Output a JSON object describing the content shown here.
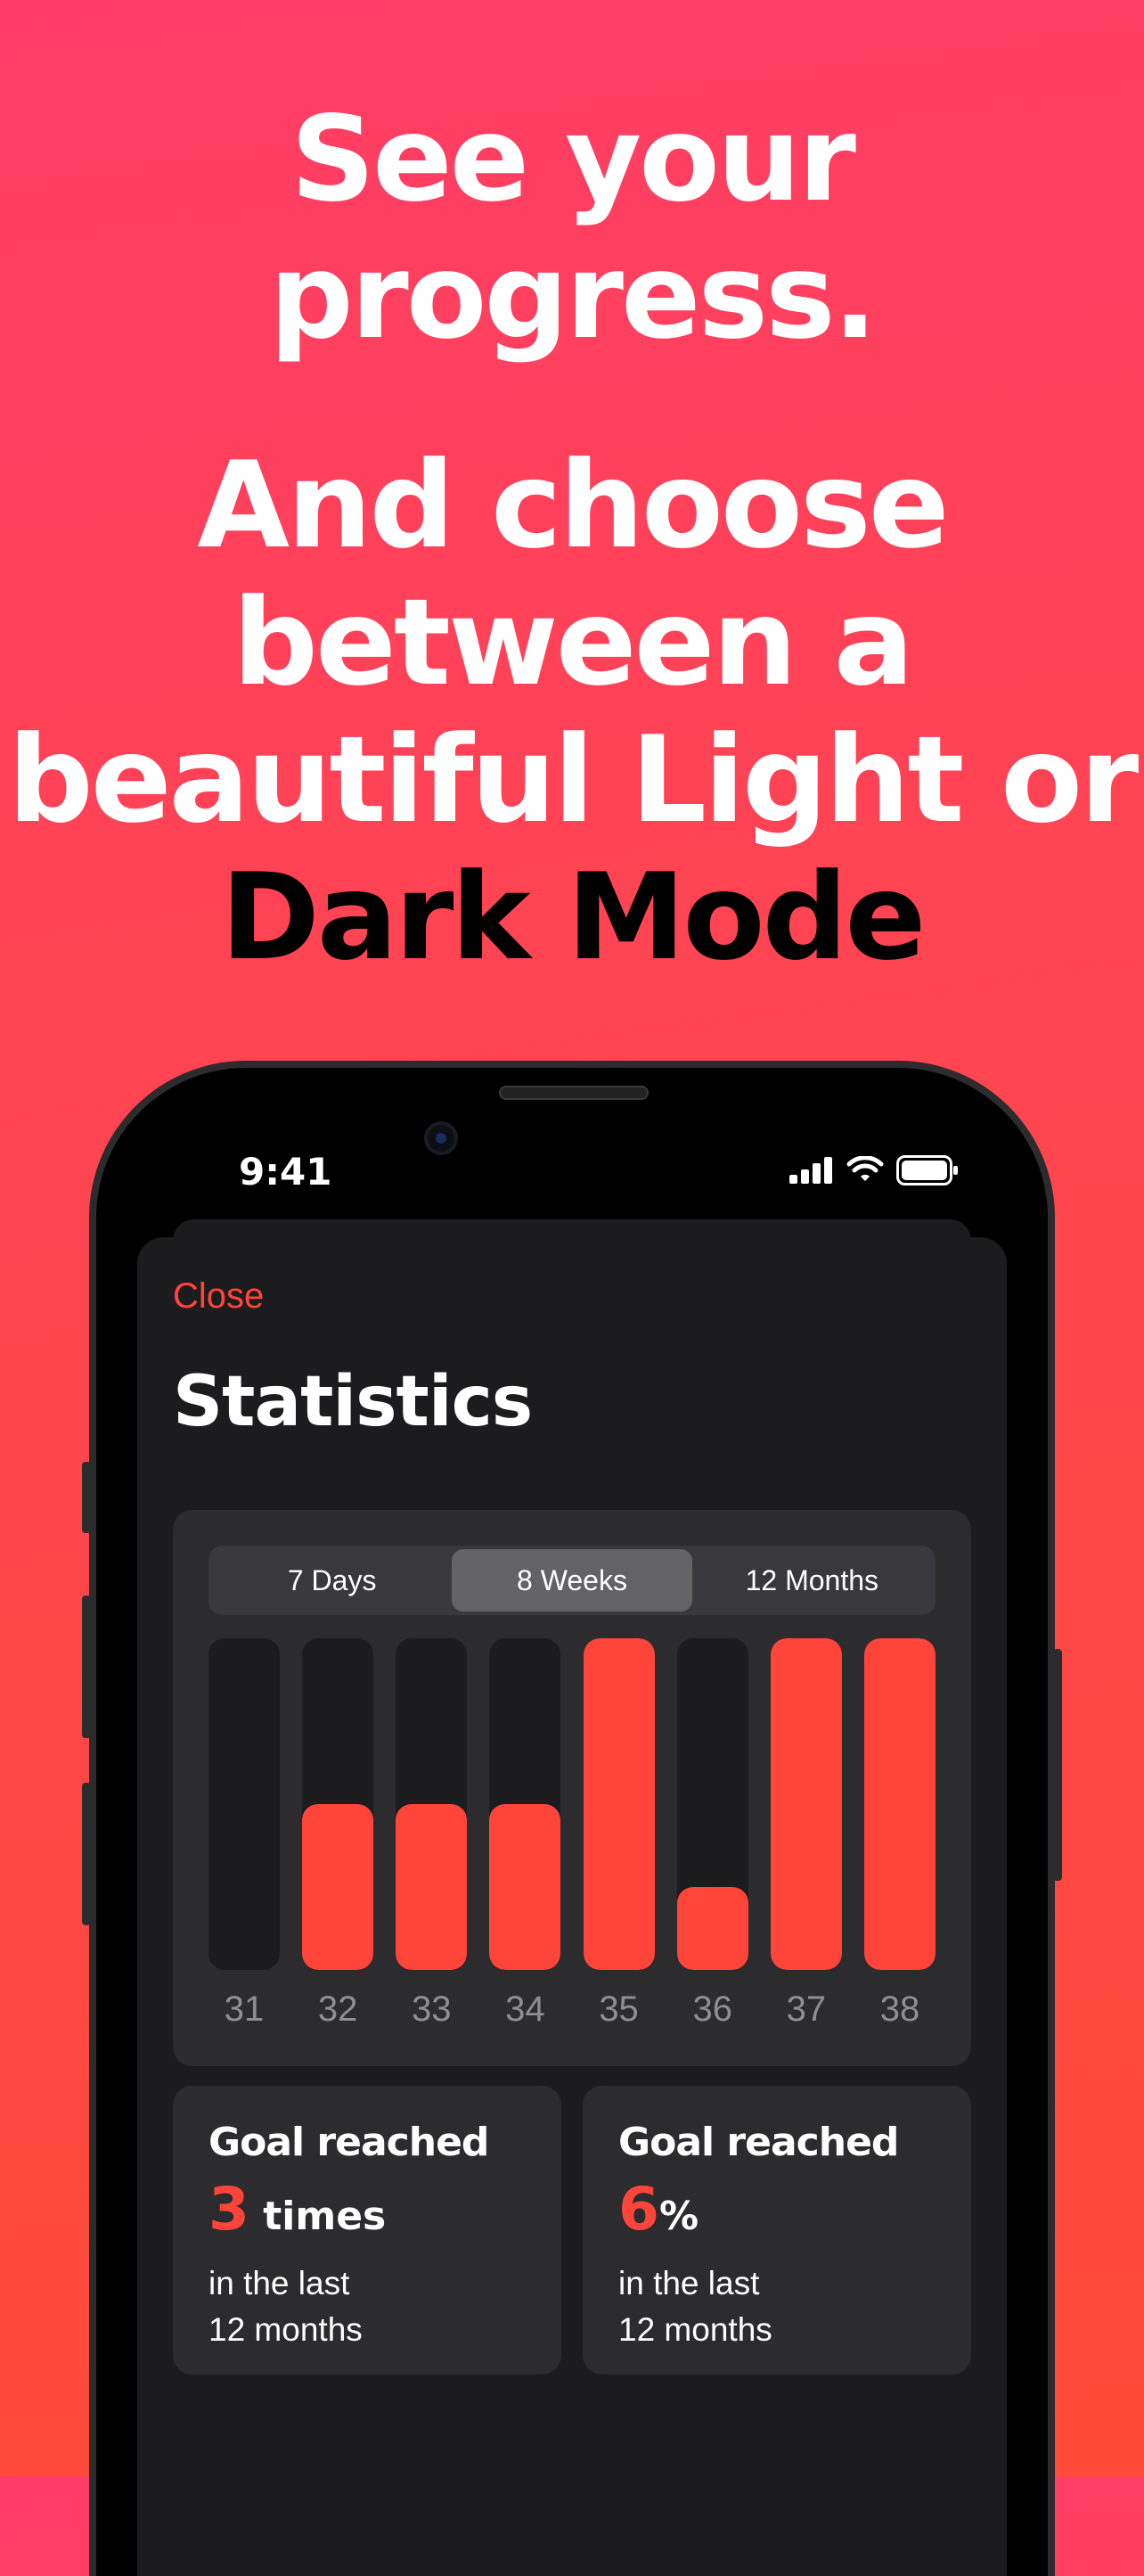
{
  "headline": {
    "line1": "See your progress.",
    "line2": "And choose between a beautiful Light or",
    "dark_word": "Dark Mode"
  },
  "status_bar": {
    "time": "9:41"
  },
  "sheet": {
    "close_label": "Close",
    "title": "Statistics"
  },
  "segmented_control": {
    "options": [
      "7 Days",
      "8 Weeks",
      "12 Months"
    ],
    "selected": "8 Weeks"
  },
  "colors": {
    "accent": "#ff453a",
    "track": "#1c1c1e"
  },
  "chart_data": {
    "type": "bar",
    "categories": [
      "31",
      "32",
      "33",
      "34",
      "35",
      "36",
      "37",
      "38"
    ],
    "values": [
      0,
      0.5,
      0.5,
      0.5,
      1,
      0.25,
      1,
      1
    ],
    "ylim": [
      0,
      1
    ],
    "grid": false
  },
  "stats": [
    {
      "title": "Goal reached",
      "number": "3",
      "unit": " times",
      "desc_line1": "in the last",
      "desc_line2": "12 months"
    },
    {
      "title": "Goal reached",
      "number": "6",
      "unit": "%",
      "desc_line1": "in the last",
      "desc_line2": "12 months"
    }
  ]
}
